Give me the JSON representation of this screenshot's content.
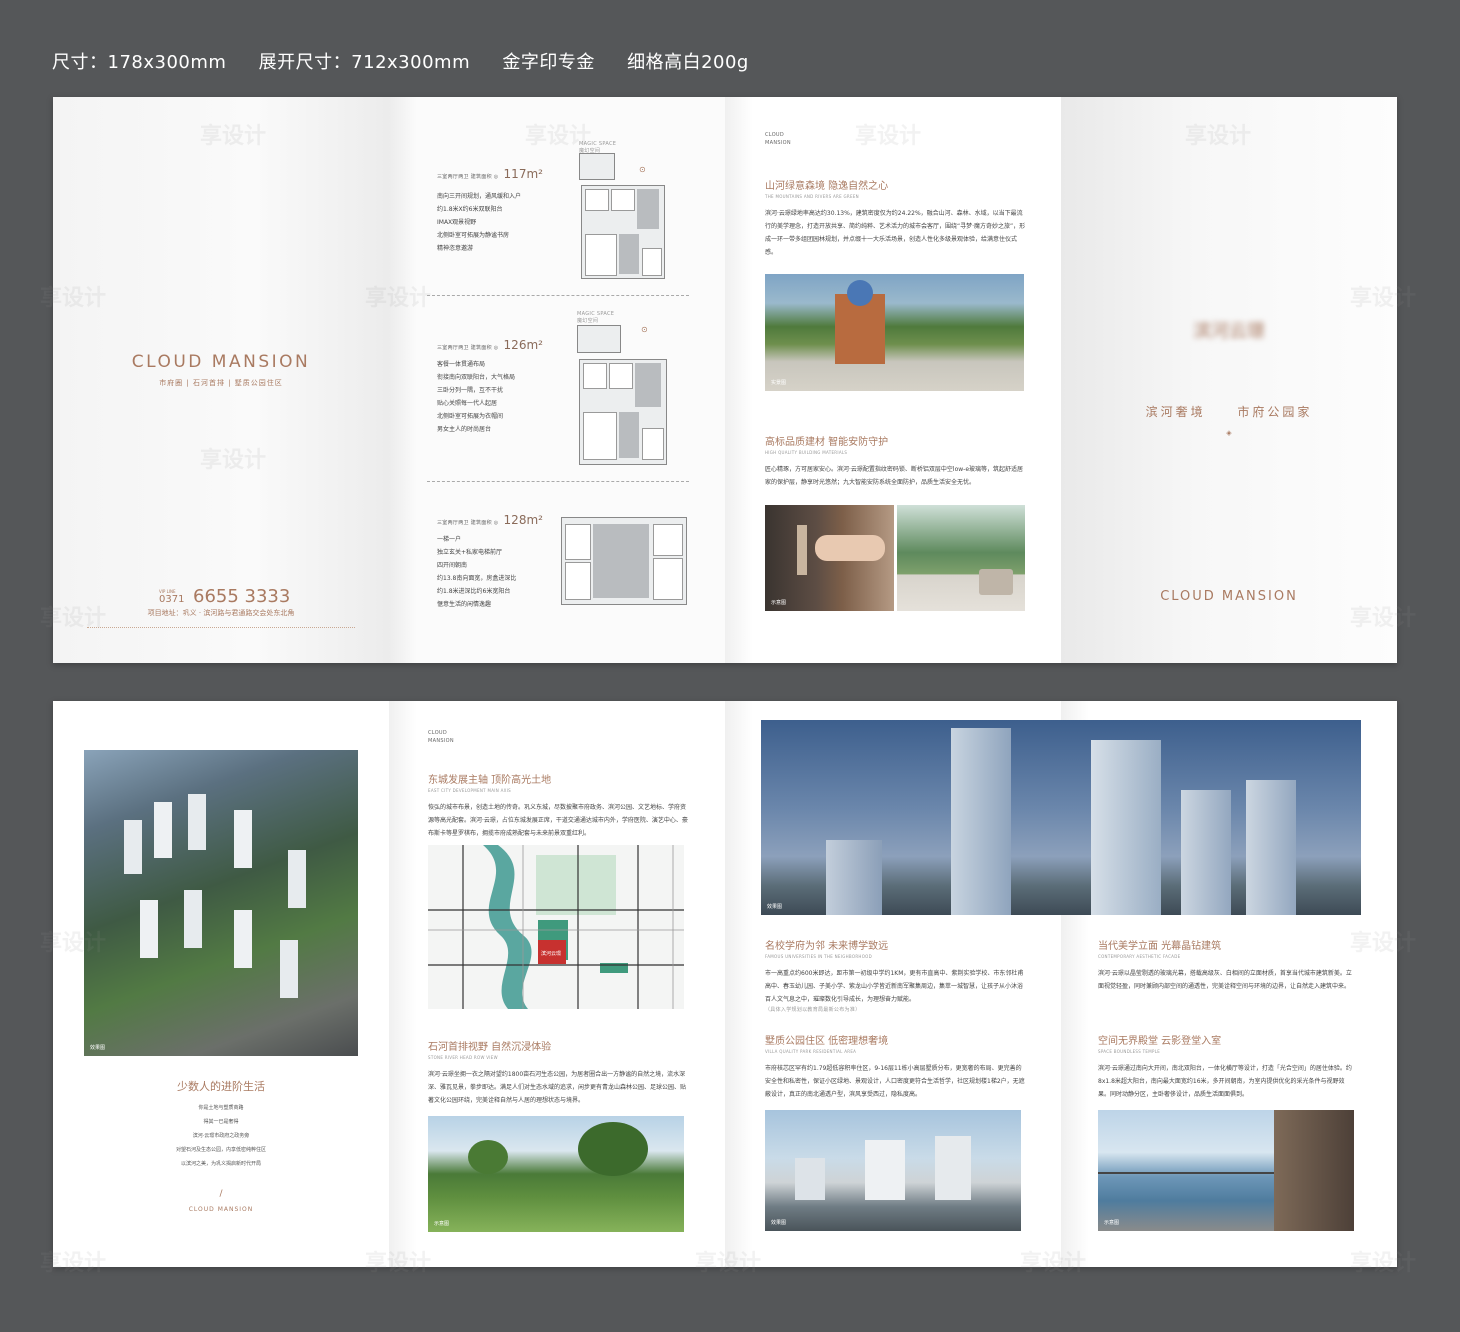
{
  "spec": {
    "size": "尺寸：178x300mm",
    "unfolded": "展开尺寸：712x300mm",
    "gold": "金字印专金",
    "paper": "细格高白200g"
  },
  "cover": {
    "title": "CLOUD MANSION",
    "subtitle": "市府圈 | 石河首排 | 墅质公园住区",
    "vip_label": "VIP LINE",
    "area_code": "0371",
    "phone": "6655 3333",
    "address": "项目地址：巩义 · 滨河路与君通路交会处东北角"
  },
  "plans": [
    {
      "header": "三室两厅两卫  建筑面积 ◎",
      "area": "117m²",
      "label": "MAGIC SPACE\n魔幻空间",
      "lines": [
        "南向三开间规划，通风缓和入户",
        "约1.8米X约6米双联阳台",
        "IMAX观景视野",
        "北侧卧室可拓展为静谧书房",
        "精神恣意邀游"
      ]
    },
    {
      "header": "三室两厅两卫  建筑面积 ◎",
      "area": "126m²",
      "label": "MAGIC SPACE\n魔幻空间",
      "lines": [
        "客餐一体贯通布局",
        "衔接南向双联阳台，大气格局",
        "三卧分列一隅，互不干扰",
        "贴心关照每一代人起居",
        "北侧卧室可拓展为衣帽间",
        "男女主人的时尚居台"
      ]
    },
    {
      "header": "三室两厅两卫  建筑面积 ◎",
      "area": "128m²",
      "lines": [
        "一梯一户",
        "独立玄关+私家电梯前厅",
        "四开间朝南",
        "约13.8南向面宽，房盒进深比",
        "约1.8米进深比约6米宽阳台",
        "惬意生活的闲情逸趣"
      ]
    }
  ],
  "landscape": {
    "brand": "CLOUD\nMANSION",
    "title": "山河绿意森境  隐逸自然之心",
    "en": "THE MOUNTAINS AND RIVERS ARE GREEN",
    "body": "滨河·云璟绿地率高达约30.13%，建筑密度仅为约24.22%，融合山河、森林、水域，以当下最流行的美学理念，打造开放共享、简约纯粹、艺术活力的城市会客厅，围绕“寻梦·魔方奇妙之旅”，形成一环一带多组团园林规划，并点缀十一大乐活场景，创造人性化多级景观体验，给满意住仪式感。",
    "caption": "实景图"
  },
  "security": {
    "title": "高标品质建材  智能安防守护",
    "en": "HIGH QUALITY BUILDING MATERIALS",
    "body": "匠心精琢，方可居家安心。滨河·云璟配置指纹密码锁、断桥铝双层中空low-e玻璃等，筑起舒适居家的保护层，静享时光悠然；九大智能安防系统全面防护，品质生活安全无忧。",
    "caption1": "示意图",
    "caption2": ""
  },
  "backcover": {
    "logo": "滨河云璟",
    "slogan_left": "滨河奢境",
    "slogan_right": "市府公园家",
    "title": "CLOUD MANSION"
  },
  "inner_left": {
    "caption": "效果图",
    "title": "少数人的进阶生活",
    "lines": [
      "你是土地与塑质商路",
      "得其一已是奢得",
      "滨河·云璟市政府之政务旁",
      "对望石河及生态公园，内享低密纯粹住区",
      "以滨河之美，为巩义揭启新时代开局"
    ],
    "brand": "CLOUD MANSION"
  },
  "location": {
    "brand": "CLOUD\nMANSION",
    "title": "东城发展主轴  顶阶高光土地",
    "en": "EAST CITY DEVELOPMENT MAIN AXIS",
    "body": "恢弘的城市布景，创造土地的传奇。巩义东城，尽数披聚市府政务、滨河公园、文艺地标、学府资源等高光配套。滨河·云璟，占位东城发展正席，干道交通通达城市内外，学府医院、演艺中心、豪布斯卡等星罗棋布，拥揽市府成熟配套与未来前景双重红利。",
    "map_label": "滨河云璟",
    "river_title": "石河首排视野  自然沉浸体验",
    "river_en": "STONE RIVER HEAD ROW VIEW",
    "river_body": "滨河·云璟坐拥一衣之隔对望约1800亩石河生态公园，为居者圈合出一方静谧的自然之境，流水深深、雅瓦见景，拳步即达。满足人们对生态水域的追求，闲步更有青龙山森林公园、足球公园、贴著文化公园环绕，完美诠释自然与人居的理想状态与境界。",
    "caption": "示意图"
  },
  "spread": {
    "hero_caption": "效果图",
    "school_title": "名校学府为邻  未来博学致远",
    "school_en": "FAMOUS UNIVERSITIES IN THE NEIGHBORHOOD",
    "school_body": "市一高重点约600米即达，距市第一初级中学约1KM，更有市直高中、紫荆实验学校、市东邻杜甫高中、春玉幼儿园、子美小学、紫龙山小学皆近新南军聚集周边，集萃一城智慧，让孩子从小沐浴百人文气息之中，璀璨数化引导成长，为理想奋力赋能。",
    "school_note": "（具体入学规划以教育局最新公布为准）",
    "villa_title": "墅质公园住区  低密理想奢境",
    "villa_en": "VILLA QUALITY PARK RESIDENTIAL AREA",
    "villa_body": "市府核芯区罕有约1.79超低容积率住区，9-16层11栋小高层墅质分布，更宽奢的布局、更完善的安全性和私密性，保证小区绿地、景观设计，人口密度更符合生活哲学，社区规划楼1梯2户，无遮蔽设计，真正的南北通透户型，滨风享受西过，隐私度高。",
    "villa_caption": "效果图",
    "facade_title": "当代美学立面  光幕晶钻建筑",
    "facade_en": "CONTEMPORARY AESTHETIC FACADE",
    "facade_body": "滨河·云璟以晶莹剔透的玻璃光幕，搭载高级灰、白相间的立面材质，首享当代城市建筑新美。立面视觉轻盈，同时兼顾内部空间的通透性，完美诠释空间与环境的边界，让自然走入建筑中来。",
    "space_title": "空间无界殿堂  云影登堂入室",
    "space_en": "SPACE BOUNDLESS TEMPLE",
    "space_body": "滨河·云璟通过南向大开间，南北双阳台，一体化横厅等设计，打造「光合空间」的居住体验。约8x1.8米超大阳台，南向最大面宽约16米，多开间朝南，为室内提供优化的采光条件与视野效果。同时动静分区，主卧奢侈设计，品质生活面面俱到。",
    "space_caption": "示意图"
  },
  "watermark": "享设计"
}
